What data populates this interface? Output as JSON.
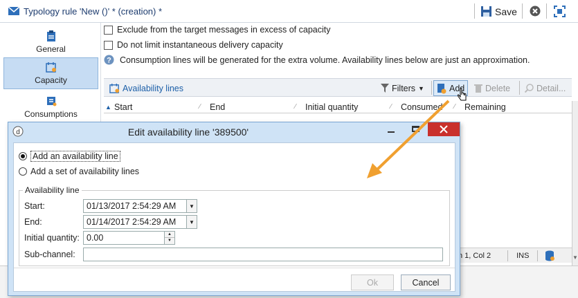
{
  "window": {
    "title": "Typology rule 'New ()' * (creation) *",
    "save_label": "Save"
  },
  "sidebar": {
    "items": [
      {
        "label": "General",
        "icon": "clipboard-icon"
      },
      {
        "label": "Capacity",
        "icon": "calendar-icon",
        "active": true
      },
      {
        "label": "Consumptions",
        "icon": "tasks-icon"
      }
    ]
  },
  "main": {
    "exclude_label": "Exclude from the target messages in excess of capacity",
    "no_limit_label": "Do not limit instantaneous delivery capacity",
    "info_text": "Consumption lines will be generated for the extra volume. Availability lines below are just an approximation.",
    "availability_lines_label": "Availability lines",
    "toolbar": {
      "filters": "Filters",
      "add": "Add",
      "delete": "Delete",
      "detail": "Detail..."
    },
    "columns": [
      "Start",
      "End",
      "Initial quantity",
      "Consumed",
      "Remaining"
    ],
    "status": {
      "position": "n 1, Col 2",
      "mode": "INS"
    }
  },
  "dialog": {
    "title": "Edit availability line '389500'",
    "options": {
      "single": "Add an availability line",
      "set": "Add a set of availability lines"
    },
    "group_label": "Availability line",
    "fields": {
      "start_label": "Start:",
      "start_value": "01/13/2017 2:54:29 AM",
      "end_label": "End:",
      "end_value": "01/14/2017 2:54:29 AM",
      "qty_label": "Initial quantity:",
      "qty_value": "0.00",
      "subchannel_label": "Sub-channel:",
      "subchannel_value": ""
    },
    "ok_label": "Ok",
    "cancel_label": "Cancel"
  },
  "colors": {
    "accent": "#1c5fa8",
    "active_bg": "#c6dcf3",
    "arrow": "#f0a030"
  }
}
